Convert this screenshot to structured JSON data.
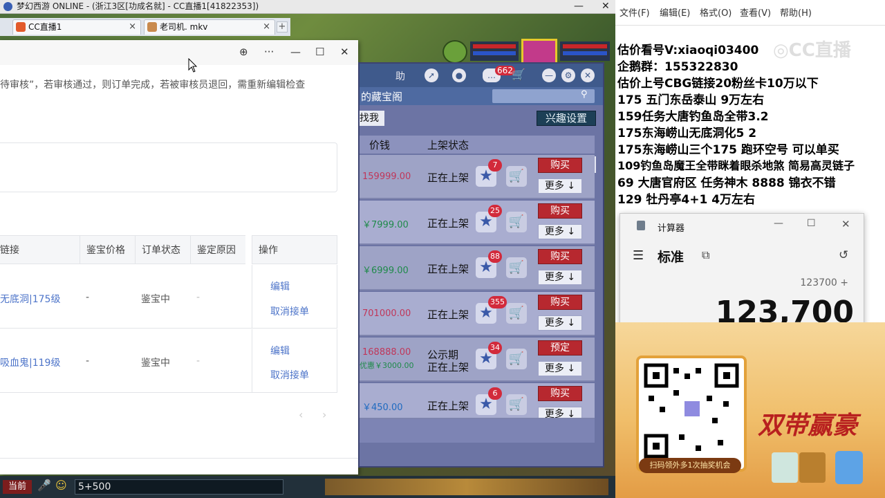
{
  "game_window": {
    "title": "梦幻西游 ONLINE - (浙江3区[功成名就] - CC直播1[41822353])",
    "tabs": [
      {
        "label": "CC直播1"
      },
      {
        "label": "老司机. mkv"
      }
    ],
    "chat_input": "5+500",
    "channel_label": "当前"
  },
  "web_panel": {
    "notice_line": "待审核”，若审核通过，则订单完成，若被审核员退回，需重新编辑检查",
    "table_headers": [
      "链接",
      "鉴宝价格",
      "订单状态",
      "鉴定原因",
      "操作"
    ],
    "rows": [
      {
        "link": "无底洞|175级",
        "price": "-",
        "status": "鉴宝中",
        "reason": "-",
        "edit": "编辑",
        "cancel": "取消接单"
      },
      {
        "link": "吸血鬼|119级",
        "price": "-",
        "status": "鉴宝中",
        "reason": "-",
        "edit": "编辑",
        "cancel": "取消接单"
      }
    ]
  },
  "shop_panel": {
    "header_help": "助",
    "message_count": "662",
    "tab_label": "的藏宝阁",
    "interest_button": "兴趣设置",
    "filter_label": "找我",
    "col_price": "价钱",
    "col_status": "上架状态",
    "items": [
      {
        "price": "159999.00",
        "status": "正在上架",
        "stars": "7",
        "action": "购买",
        "more": "更多"
      },
      {
        "price": "￥7999.00",
        "status": "正在上架",
        "stars": "25",
        "action": "购买",
        "more": "更多"
      },
      {
        "price": "￥6999.00",
        "status": "正在上架",
        "stars": "88",
        "action": "购买",
        "more": "更多"
      },
      {
        "price": "701000.00",
        "status": "正在上架",
        "stars": "355",
        "action": "购买",
        "more": "更多"
      },
      {
        "price": "168888.00",
        "price2": "优惠￥3000.00",
        "status": "公示期",
        "status2": "正在上架",
        "stars": "34",
        "action": "预定",
        "more": "更多"
      },
      {
        "price": "￥450.00",
        "status": "正在上架",
        "stars": "6",
        "action": "购买",
        "more": "更多"
      }
    ]
  },
  "notepad": {
    "menu": [
      "文件(F)",
      "编辑(E)",
      "格式(O)",
      "查看(V)",
      "帮助(H)"
    ],
    "lines": [
      "估价看号V:xiaoqi03400",
      "企鹅群：155322830",
      "估价上号CBG链接20粉丝卡10万以下",
      "175 五门东岳泰山  9万左右",
      "159任务大唐钓鱼岛全带3.2",
      "175东海崂山无底洞化5  2",
      "175东海崂山三个175 跑环空号 可以单买",
      "109钓鱼岛魔王全带眯着眼杀地煞 简易高灵链子",
      "69  大唐官府区 任务神木 8888 锦衣不错",
      "129 牡丹亭4+1 4万左右"
    ]
  },
  "calculator": {
    "title": "计算器",
    "mode": "标准",
    "expression": "123700 +",
    "display": "123,700"
  },
  "promo": {
    "slogan": "双带赢豪",
    "scan_text": "扫码领外多1次抽奖机会"
  }
}
